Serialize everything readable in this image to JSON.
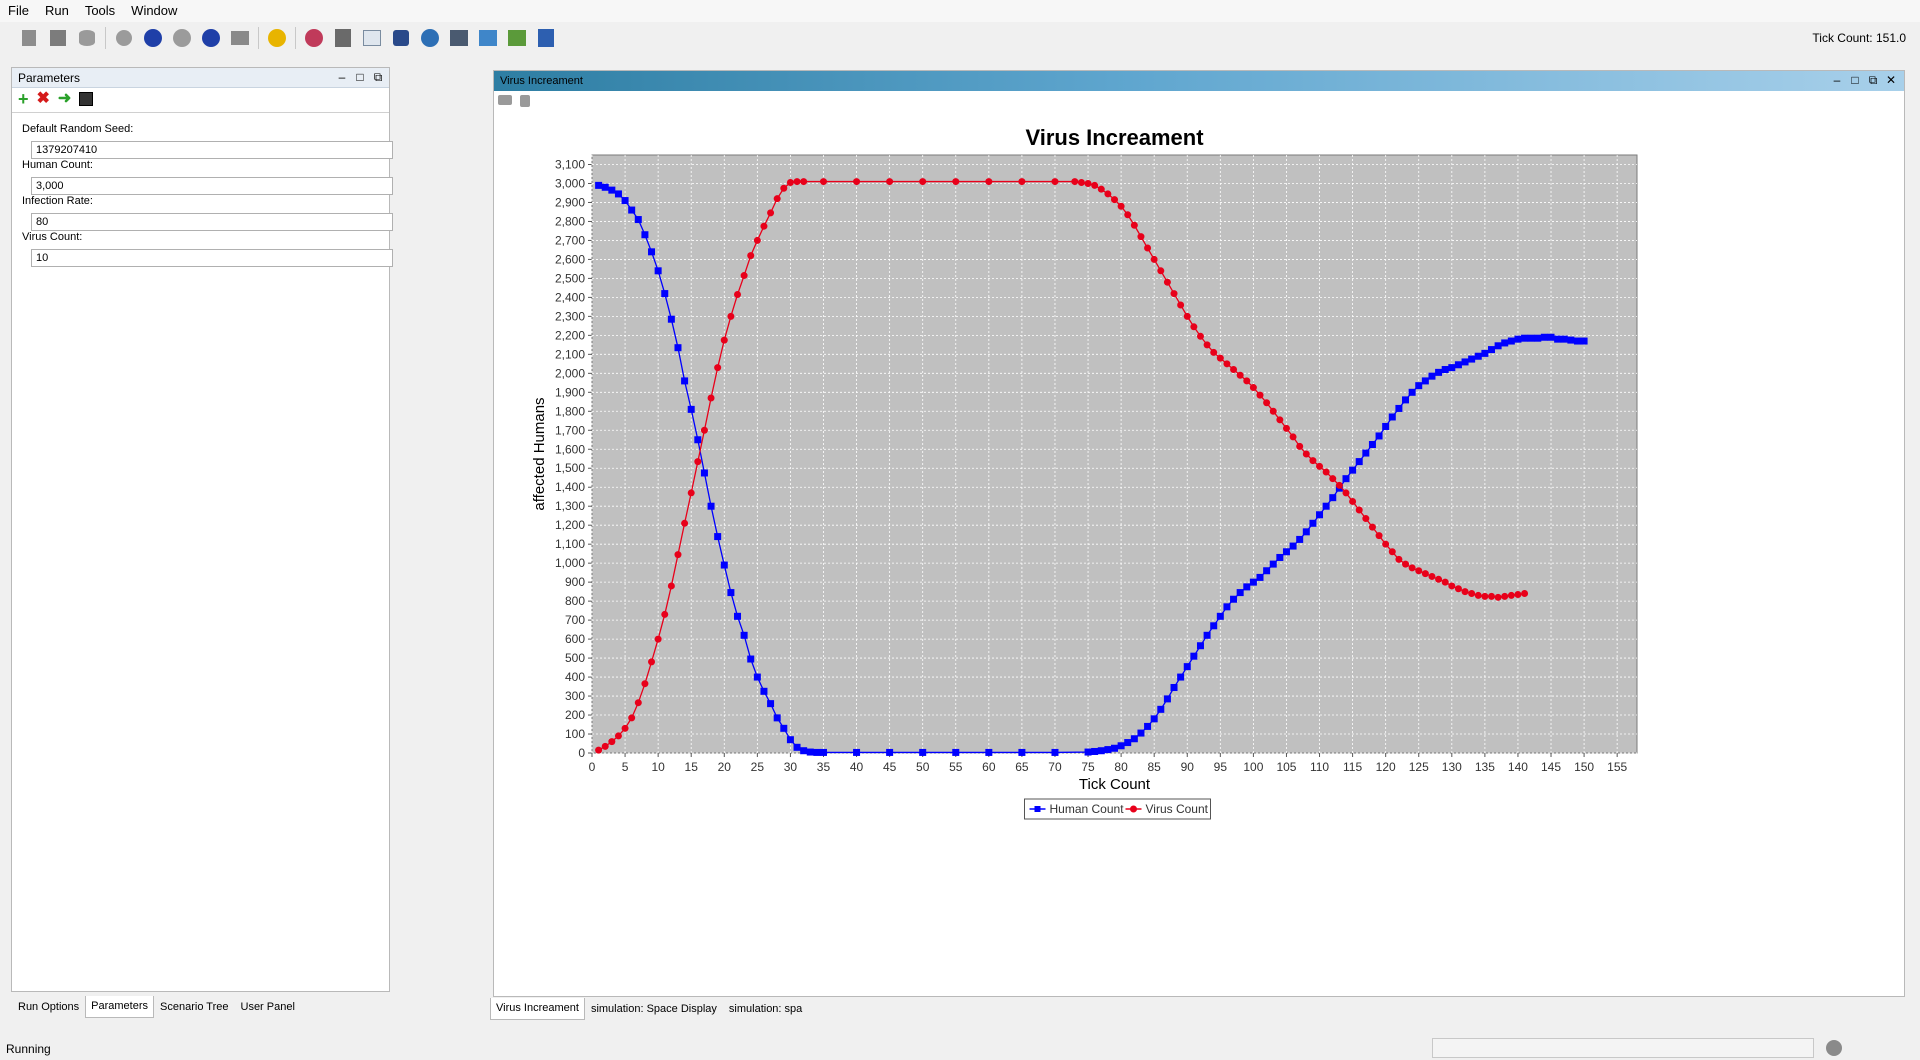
{
  "menu": [
    "File",
    "Run",
    "Tools",
    "Window"
  ],
  "toolbar_icons": [
    "open-icon",
    "save-icon",
    "database-icon",
    "step-icon",
    "pause-icon",
    "play-icon",
    "stop-icon",
    "reset-icon",
    "info-icon",
    "chart-icon",
    "export-icon",
    "grid-icon",
    "monitor-icon",
    "globe-icon",
    "movie-icon",
    "zoom-icon",
    "picture-icon",
    "app-icon"
  ],
  "tick_count_label": "Tick Count: 151.0",
  "parameters_panel": {
    "title": "Parameters",
    "fields": [
      {
        "label": "Default Random Seed:",
        "value": "1379207410"
      },
      {
        "label": "Human Count:",
        "value": "3,000"
      },
      {
        "label": "Infection Rate:",
        "value": "80"
      },
      {
        "label": "Virus Count:",
        "value": "10"
      }
    ],
    "tabs": [
      "Run Options",
      "Parameters",
      "Scenario Tree",
      "User Panel"
    ],
    "active_tab": "Parameters"
  },
  "chart_panel": {
    "title": "Virus Increament",
    "tabs": [
      "Virus Increament",
      "simulation: Space Display",
      "simulation: spa"
    ],
    "active_tab": "Virus Increament"
  },
  "status": {
    "text": "Running"
  },
  "colors": {
    "human": "#0000ff",
    "virus": "#e8001a",
    "plot_bg": "#c0c0c0",
    "titlebar": "#3c8fb8"
  },
  "chart_data": {
    "type": "line",
    "title": "Virus Increament",
    "xlabel": "Tick Count",
    "ylabel": "affected Humans",
    "xlim": [
      0,
      158
    ],
    "ylim": [
      0,
      3150
    ],
    "x_ticks": [
      "0",
      "5",
      "10",
      "15",
      "20",
      "25",
      "30",
      "35",
      "40",
      "45",
      "50",
      "55",
      "60",
      "65",
      "70",
      "75",
      "80",
      "85",
      "90",
      "95",
      "100",
      "105",
      "110",
      "115",
      "120",
      "125",
      "130",
      "135",
      "140",
      "145",
      "150",
      "155"
    ],
    "y_ticks": [
      "0",
      "100",
      "200",
      "300",
      "400",
      "500",
      "600",
      "700",
      "800",
      "900",
      "1,000",
      "1,100",
      "1,200",
      "1,300",
      "1,400",
      "1,500",
      "1,600",
      "1,700",
      "1,800",
      "1,900",
      "2,000",
      "2,100",
      "2,200",
      "2,300",
      "2,400",
      "2,500",
      "2,600",
      "2,700",
      "2,800",
      "2,900",
      "3,000",
      "3,100"
    ],
    "grid": true,
    "legend_position": "bottom-center",
    "series": [
      {
        "name": "Human Count",
        "marker": "square",
        "color": "#0000ff",
        "points": [
          [
            1,
            2990
          ],
          [
            2,
            2980
          ],
          [
            3,
            2965
          ],
          [
            4,
            2945
          ],
          [
            5,
            2910
          ],
          [
            6,
            2860
          ],
          [
            7,
            2810
          ],
          [
            8,
            2730
          ],
          [
            9,
            2640
          ],
          [
            10,
            2540
          ],
          [
            11,
            2420
          ],
          [
            12,
            2285
          ],
          [
            13,
            2135
          ],
          [
            14,
            1960
          ],
          [
            15,
            1810
          ],
          [
            16,
            1650
          ],
          [
            17,
            1475
          ],
          [
            18,
            1300
          ],
          [
            19,
            1140
          ],
          [
            20,
            990
          ],
          [
            21,
            845
          ],
          [
            22,
            720
          ],
          [
            23,
            620
          ],
          [
            24,
            495
          ],
          [
            25,
            400
          ],
          [
            26,
            325
          ],
          [
            27,
            260
          ],
          [
            28,
            185
          ],
          [
            29,
            130
          ],
          [
            30,
            70
          ],
          [
            31,
            30
          ],
          [
            32,
            12
          ],
          [
            33,
            5
          ],
          [
            34,
            3
          ],
          [
            35,
            3
          ],
          [
            40,
            3
          ],
          [
            45,
            3
          ],
          [
            50,
            3
          ],
          [
            55,
            3
          ],
          [
            60,
            3
          ],
          [
            65,
            3
          ],
          [
            70,
            3
          ],
          [
            75,
            5
          ],
          [
            76,
            8
          ],
          [
            77,
            12
          ],
          [
            78,
            18
          ],
          [
            79,
            25
          ],
          [
            80,
            38
          ],
          [
            81,
            55
          ],
          [
            82,
            75
          ],
          [
            83,
            105
          ],
          [
            84,
            140
          ],
          [
            85,
            180
          ],
          [
            86,
            230
          ],
          [
            87,
            285
          ],
          [
            88,
            345
          ],
          [
            89,
            400
          ],
          [
            90,
            455
          ],
          [
            91,
            510
          ],
          [
            92,
            565
          ],
          [
            93,
            620
          ],
          [
            94,
            670
          ],
          [
            95,
            720
          ],
          [
            96,
            770
          ],
          [
            97,
            810
          ],
          [
            98,
            845
          ],
          [
            99,
            875
          ],
          [
            100,
            900
          ],
          [
            101,
            925
          ],
          [
            102,
            960
          ],
          [
            103,
            995
          ],
          [
            104,
            1030
          ],
          [
            105,
            1060
          ],
          [
            106,
            1090
          ],
          [
            107,
            1125
          ],
          [
            108,
            1165
          ],
          [
            109,
            1210
          ],
          [
            110,
            1255
          ],
          [
            111,
            1300
          ],
          [
            112,
            1345
          ],
          [
            113,
            1395
          ],
          [
            114,
            1445
          ],
          [
            115,
            1490
          ],
          [
            116,
            1535
          ],
          [
            117,
            1580
          ],
          [
            118,
            1625
          ],
          [
            119,
            1670
          ],
          [
            120,
            1720
          ],
          [
            121,
            1770
          ],
          [
            122,
            1815
          ],
          [
            123,
            1860
          ],
          [
            124,
            1900
          ],
          [
            125,
            1935
          ],
          [
            126,
            1960
          ],
          [
            127,
            1985
          ],
          [
            128,
            2005
          ],
          [
            129,
            2020
          ],
          [
            130,
            2030
          ],
          [
            131,
            2045
          ],
          [
            132,
            2060
          ],
          [
            133,
            2075
          ],
          [
            134,
            2090
          ],
          [
            135,
            2105
          ],
          [
            136,
            2125
          ],
          [
            137,
            2145
          ],
          [
            138,
            2160
          ],
          [
            139,
            2170
          ],
          [
            140,
            2180
          ],
          [
            141,
            2185
          ],
          [
            142,
            2185
          ],
          [
            143,
            2185
          ],
          [
            144,
            2190
          ],
          [
            145,
            2190
          ],
          [
            146,
            2180
          ],
          [
            147,
            2180
          ],
          [
            148,
            2175
          ],
          [
            149,
            2170
          ],
          [
            150,
            2170
          ]
        ]
      },
      {
        "name": "Virus Count",
        "marker": "circle",
        "color": "#e8001a",
        "points": [
          [
            1,
            15
          ],
          [
            2,
            35
          ],
          [
            3,
            60
          ],
          [
            4,
            90
          ],
          [
            5,
            130
          ],
          [
            6,
            185
          ],
          [
            7,
            265
          ],
          [
            8,
            365
          ],
          [
            9,
            480
          ],
          [
            10,
            600
          ],
          [
            11,
            730
          ],
          [
            12,
            880
          ],
          [
            13,
            1045
          ],
          [
            14,
            1210
          ],
          [
            15,
            1370
          ],
          [
            16,
            1535
          ],
          [
            17,
            1700
          ],
          [
            18,
            1870
          ],
          [
            19,
            2030
          ],
          [
            20,
            2175
          ],
          [
            21,
            2300
          ],
          [
            22,
            2415
          ],
          [
            23,
            2515
          ],
          [
            24,
            2620
          ],
          [
            25,
            2700
          ],
          [
            26,
            2775
          ],
          [
            27,
            2845
          ],
          [
            28,
            2920
          ],
          [
            29,
            2975
          ],
          [
            30,
            3005
          ],
          [
            31,
            3010
          ],
          [
            32,
            3010
          ],
          [
            35,
            3010
          ],
          [
            40,
            3010
          ],
          [
            45,
            3010
          ],
          [
            50,
            3010
          ],
          [
            55,
            3010
          ],
          [
            60,
            3010
          ],
          [
            65,
            3010
          ],
          [
            70,
            3010
          ],
          [
            73,
            3010
          ],
          [
            74,
            3005
          ],
          [
            75,
            3000
          ],
          [
            76,
            2990
          ],
          [
            77,
            2970
          ],
          [
            78,
            2945
          ],
          [
            79,
            2915
          ],
          [
            80,
            2880
          ],
          [
            81,
            2835
          ],
          [
            82,
            2780
          ],
          [
            83,
            2720
          ],
          [
            84,
            2660
          ],
          [
            85,
            2600
          ],
          [
            86,
            2540
          ],
          [
            87,
            2480
          ],
          [
            88,
            2420
          ],
          [
            89,
            2360
          ],
          [
            90,
            2300
          ],
          [
            91,
            2245
          ],
          [
            92,
            2195
          ],
          [
            93,
            2150
          ],
          [
            94,
            2110
          ],
          [
            95,
            2080
          ],
          [
            96,
            2050
          ],
          [
            97,
            2020
          ],
          [
            98,
            1990
          ],
          [
            99,
            1960
          ],
          [
            100,
            1925
          ],
          [
            101,
            1885
          ],
          [
            102,
            1845
          ],
          [
            103,
            1800
          ],
          [
            104,
            1755
          ],
          [
            105,
            1710
          ],
          [
            106,
            1665
          ],
          [
            107,
            1615
          ],
          [
            108,
            1575
          ],
          [
            109,
            1540
          ],
          [
            110,
            1510
          ],
          [
            111,
            1480
          ],
          [
            112,
            1445
          ],
          [
            113,
            1410
          ],
          [
            114,
            1370
          ],
          [
            115,
            1325
          ],
          [
            116,
            1280
          ],
          [
            117,
            1235
          ],
          [
            118,
            1190
          ],
          [
            119,
            1145
          ],
          [
            120,
            1100
          ],
          [
            121,
            1060
          ],
          [
            122,
            1020
          ],
          [
            123,
            995
          ],
          [
            124,
            975
          ],
          [
            125,
            960
          ],
          [
            126,
            945
          ],
          [
            127,
            930
          ],
          [
            128,
            915
          ],
          [
            129,
            900
          ],
          [
            130,
            880
          ],
          [
            131,
            865
          ],
          [
            132,
            850
          ],
          [
            133,
            840
          ],
          [
            134,
            830
          ],
          [
            135,
            825
          ],
          [
            136,
            825
          ],
          [
            137,
            820
          ],
          [
            138,
            825
          ],
          [
            139,
            830
          ],
          [
            140,
            835
          ],
          [
            141,
            840
          ]
        ]
      }
    ]
  }
}
